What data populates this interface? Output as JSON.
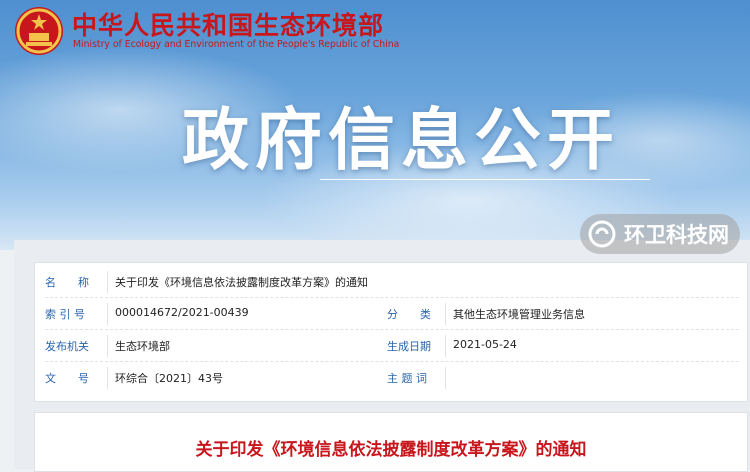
{
  "header": {
    "ministry_name_cn": "中华人民共和国生态环境部",
    "ministry_name_en": "Ministry of Ecology and Environment of the People's Republic of China",
    "banner_title": "政府信息公开",
    "emblem_icon": "national-emblem-icon"
  },
  "watermark": {
    "text": "环卫科技网",
    "icon": "watermark-logo-icon"
  },
  "metadata": {
    "name_label": "名　　称",
    "name_value": "关于印发《环境信息依法披露制度改革方案》的通知",
    "index_label": "索 引 号",
    "index_value": "000014672/2021-00439",
    "category_label": "分　　类",
    "category_value": "其他生态环境管理业务信息",
    "issuer_label": "发布机关",
    "issuer_value": "生态环境部",
    "date_label": "生成日期",
    "date_value": "2021-05-24",
    "docno_label": "文　　号",
    "docno_value": "环综合〔2021〕43号",
    "subject_label": "主 题 词",
    "subject_value": ""
  },
  "document": {
    "title": "关于印发《环境信息依法披露制度改革方案》的通知"
  },
  "colors": {
    "brand_red": "#c8161d",
    "label_blue": "#2a64ad",
    "sky_blue": "#5e9ad6"
  }
}
